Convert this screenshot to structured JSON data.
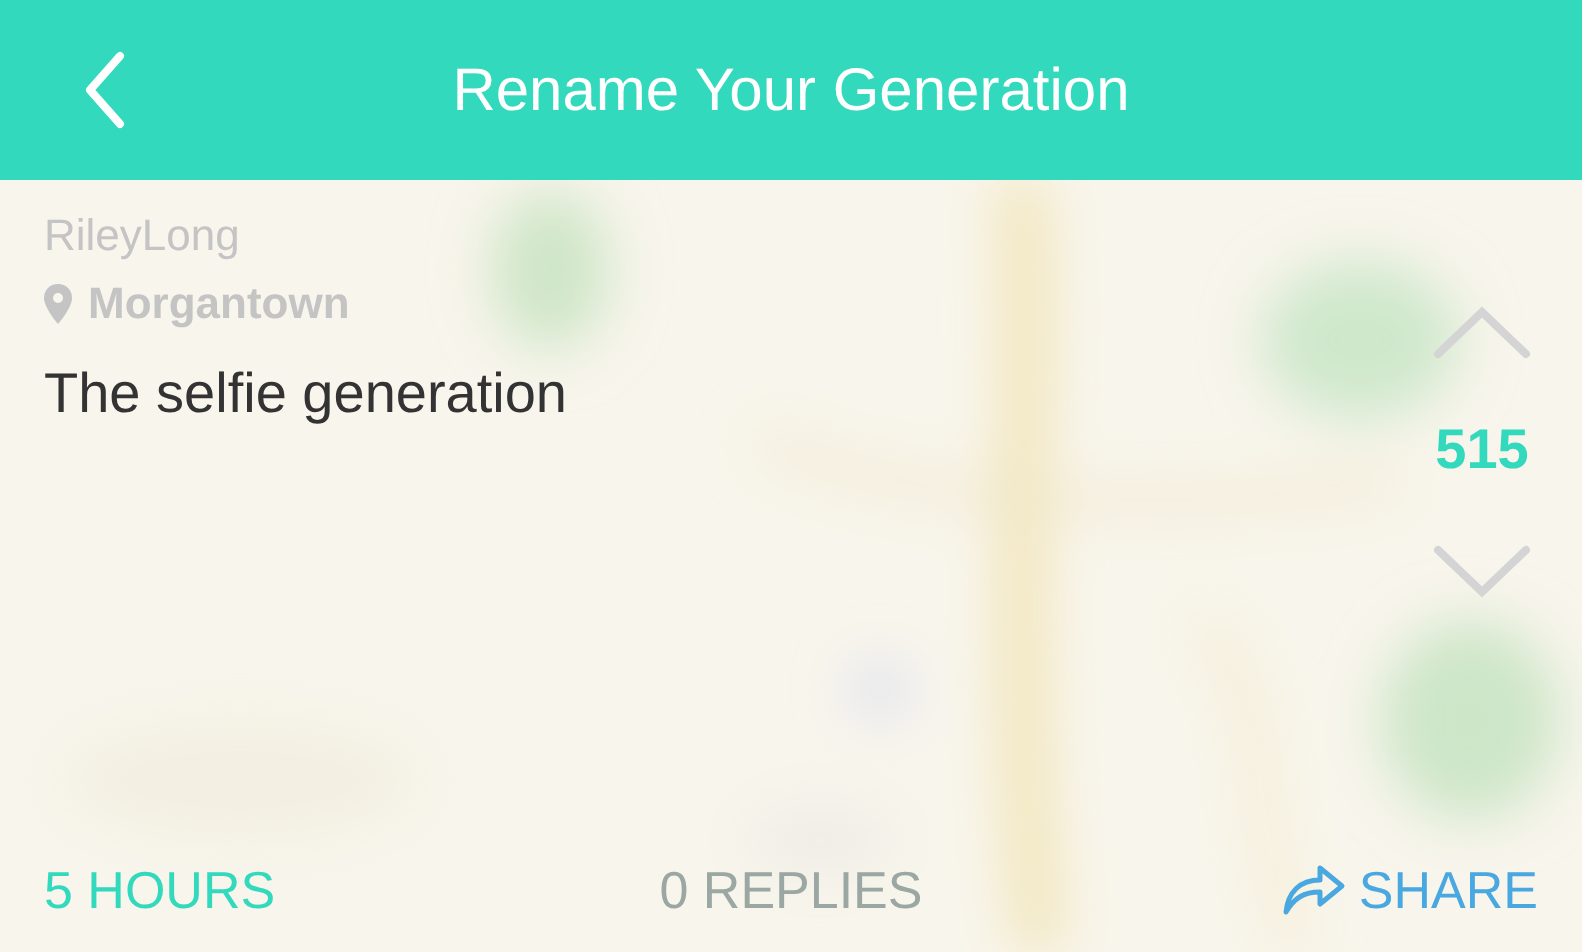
{
  "header": {
    "title": "Rename Your Generation"
  },
  "post": {
    "author": "RileyLong",
    "location": "Morgantown",
    "message": "The selfie generation",
    "votes": "515"
  },
  "footer": {
    "time": "5 HOURS",
    "replies": "0 REPLIES",
    "share": "SHARE"
  }
}
